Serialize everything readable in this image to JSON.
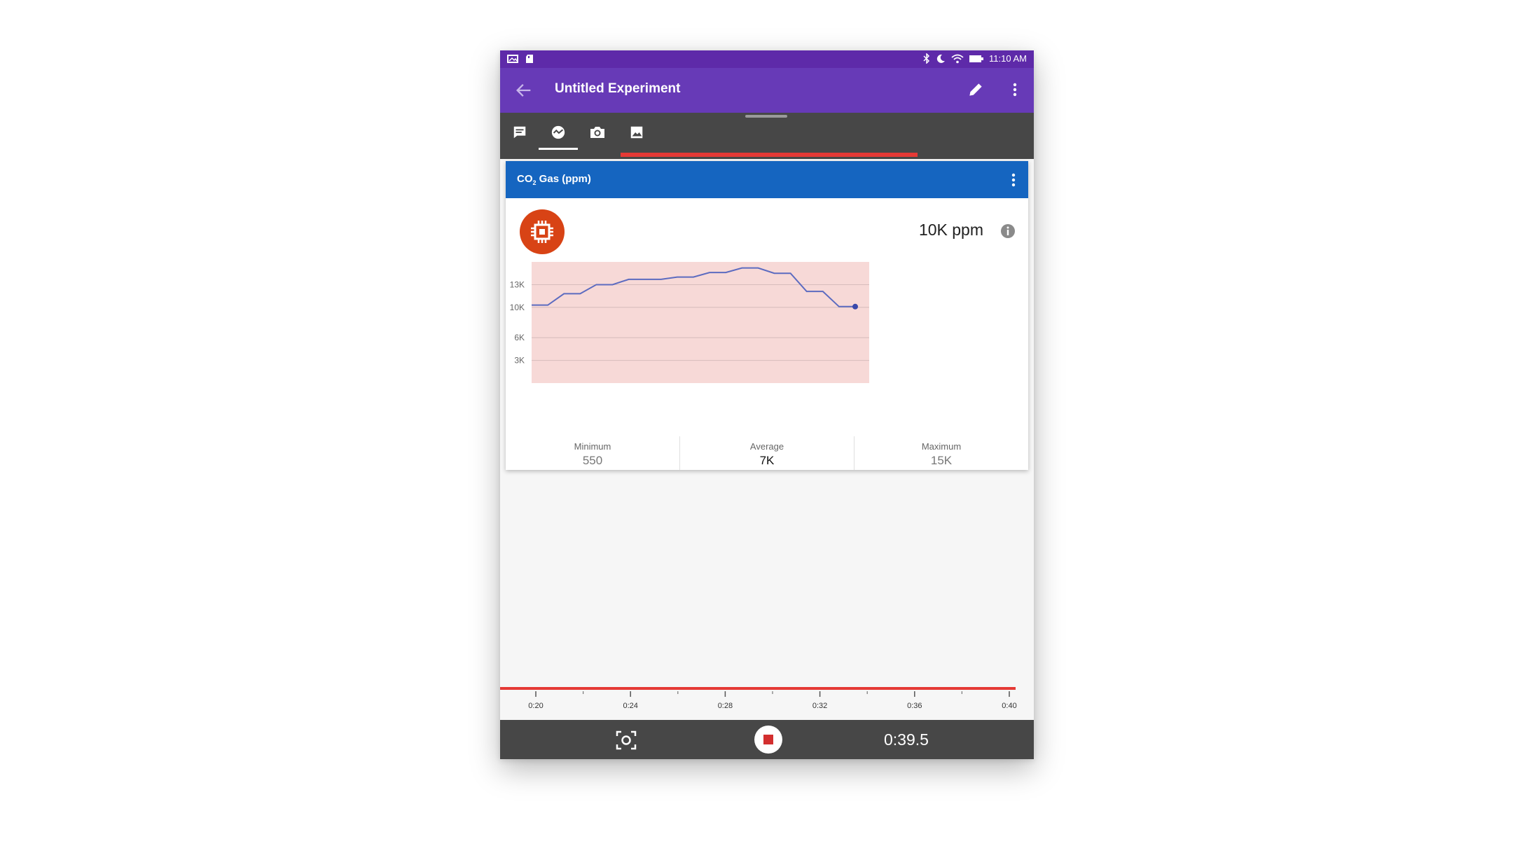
{
  "status_bar": {
    "time": "11:10 AM",
    "icons": [
      "gallery-icon",
      "sd-card-icon",
      "bluetooth-icon",
      "moon-icon",
      "wifi-icon",
      "battery-icon"
    ]
  },
  "app_bar": {
    "title": "Untitled Experiment",
    "icons": [
      "back-arrow-icon",
      "edit-pencil-icon",
      "more-vert-icon"
    ]
  },
  "tabs": [
    {
      "icon": "note-icon",
      "active": false
    },
    {
      "icon": "sensor-wave-icon",
      "active": true
    },
    {
      "icon": "camera-icon",
      "active": false
    },
    {
      "icon": "image-icon",
      "active": false
    }
  ],
  "sensor_card": {
    "title_main": "CO",
    "title_sub": "2",
    "title_rest": " Gas (ppm)",
    "reading": "10K ppm",
    "header_color": "#1565c0",
    "icon_color": "#d84315",
    "stats": [
      {
        "label": "Minimum",
        "value": "550"
      },
      {
        "label": "Average",
        "value": "7K"
      },
      {
        "label": "Maximum",
        "value": "15K"
      }
    ]
  },
  "chart_data": {
    "type": "line",
    "title": "",
    "xlabel": "",
    "ylabel": "",
    "ylim": [
      0,
      16000
    ],
    "y_ticks": [
      {
        "value": 3000,
        "label": "3K"
      },
      {
        "value": 6000,
        "label": "6K"
      },
      {
        "value": 10000,
        "label": "10K"
      },
      {
        "value": 13000,
        "label": "13K"
      }
    ],
    "grid": true,
    "background_color": "#f7d9d7",
    "line_color": "#5c6bc0",
    "series": [
      {
        "values": [
          10300,
          10300,
          11800,
          11800,
          13000,
          13000,
          13700,
          13700,
          13700,
          14000,
          14000,
          14600,
          14600,
          15200,
          15200,
          14500,
          14500,
          12100,
          12100,
          10100,
          10100
        ]
      }
    ]
  },
  "timeline": {
    "tick_labels": [
      "0:20",
      "0:24",
      "0:28",
      "0:32",
      "0:36",
      "0:40"
    ],
    "bar_color": "#e53935"
  },
  "bottom_bar": {
    "elapsed": "0:39.5",
    "icons": [
      "snapshot-icon",
      "stop-record-icon"
    ]
  }
}
